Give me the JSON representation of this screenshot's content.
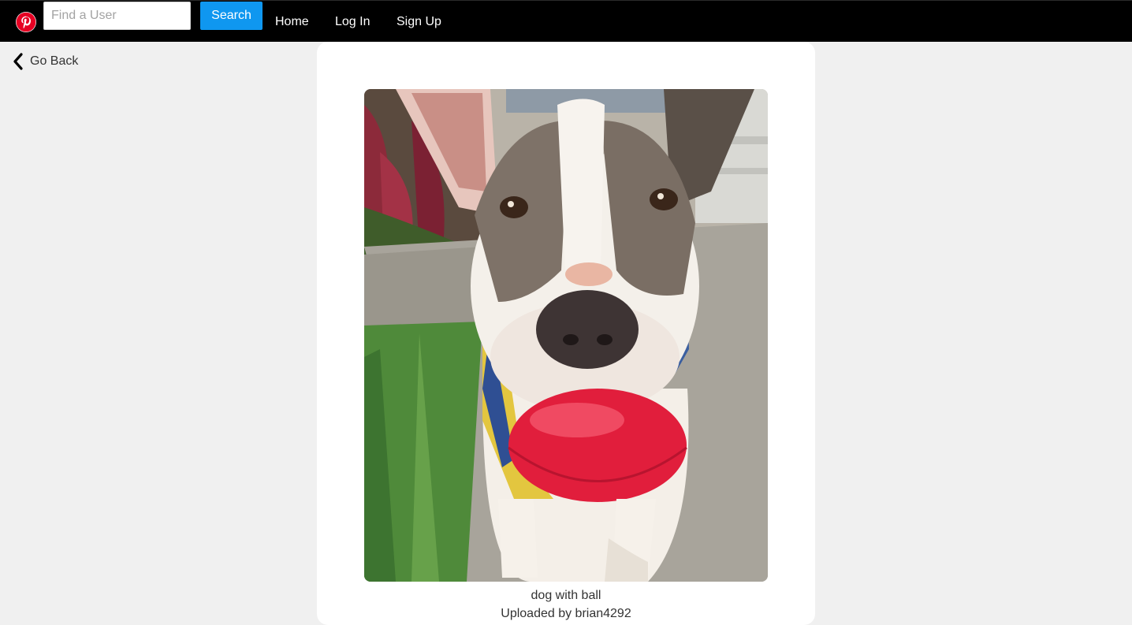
{
  "navbar": {
    "logo_icon": "pinterest-logo-icon",
    "search": {
      "placeholder": "Find a User",
      "value": "",
      "button_label": "Search"
    },
    "links": {
      "home": "Home",
      "login": "Log In",
      "signup": "Sign Up"
    }
  },
  "go_back": {
    "icon": "chevron-left-icon",
    "label": "Go Back"
  },
  "pin": {
    "caption": "dog with ball",
    "uploaded_by": "Uploaded by brian4292"
  },
  "colors": {
    "navbar_bg": "#000000",
    "accent": "#0f97f0",
    "logo_red": "#e60023",
    "page_bg": "#f0f0f0",
    "card_bg": "#ffffff"
  }
}
